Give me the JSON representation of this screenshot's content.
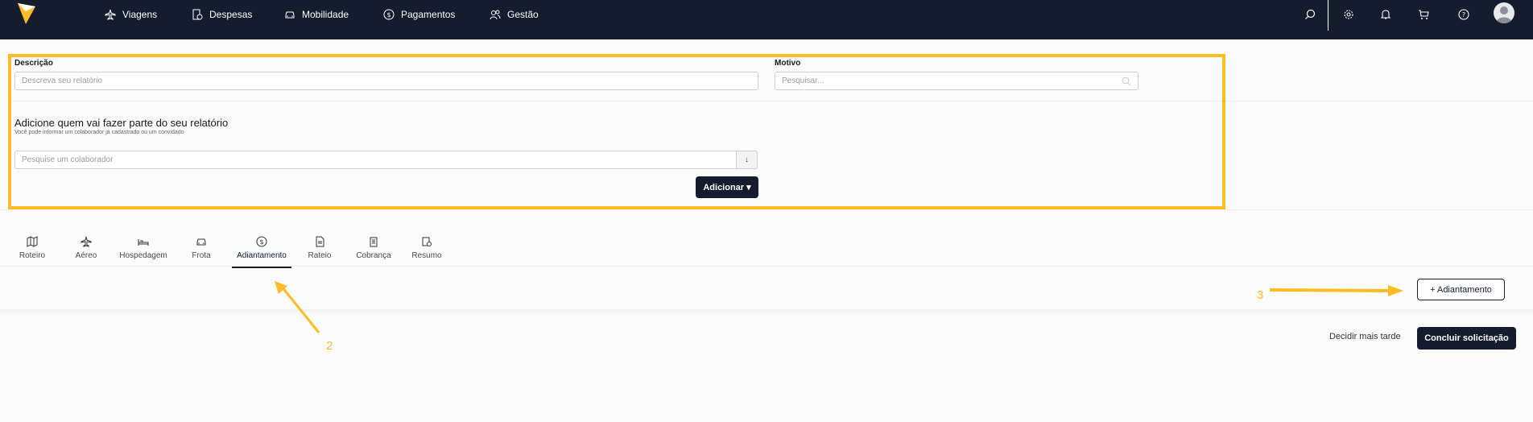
{
  "nav": {
    "items": [
      {
        "label": "Viagens",
        "icon": "plane-icon"
      },
      {
        "label": "Despesas",
        "icon": "receipt-icon"
      },
      {
        "label": "Mobilidade",
        "icon": "car-icon"
      },
      {
        "label": "Pagamentos",
        "icon": "dollar-icon"
      },
      {
        "label": "Gestão",
        "icon": "users-icon"
      }
    ],
    "right_icons": [
      "search-icon",
      "gear-icon",
      "bell-icon",
      "cart-icon",
      "help-icon",
      "avatar-icon"
    ]
  },
  "form": {
    "descricao_label": "Descrição",
    "descricao_placeholder": "Descreva seu relatório",
    "motivo_label": "Motivo",
    "motivo_placeholder": "Pesquisar...",
    "participants_title": "Adicione quem vai fazer parte do seu relatório",
    "participants_subtitle": "Você pode informar um colaborador já cadastrado ou um convidado",
    "colaborador_placeholder": "Pesquise um colaborador",
    "dropdown_glyph": "↓",
    "add_button": "Adicionar ▾"
  },
  "tabs": [
    {
      "label": "Roteiro",
      "icon": "map-icon"
    },
    {
      "label": "Aéreo",
      "icon": "plane-icon"
    },
    {
      "label": "Hospedagem",
      "icon": "bed-icon"
    },
    {
      "label": "Frota",
      "icon": "car-icon"
    },
    {
      "label": "Adiantamento",
      "icon": "dollar-icon",
      "active": true
    },
    {
      "label": "Rateio",
      "icon": "document-icon"
    },
    {
      "label": "Cobrança",
      "icon": "clipboard-icon"
    },
    {
      "label": "Resumo",
      "icon": "summary-icon"
    }
  ],
  "actions": {
    "add_advance": "+ Adiantamento",
    "decide_later": "Decidir mais tarde",
    "conclude": "Concluir solicitação"
  },
  "annotations": {
    "step2": "2",
    "step3": "3"
  },
  "colors": {
    "nav_bg": "#141c2e",
    "highlight": "#fbbd23",
    "primary": "#141c2e"
  }
}
